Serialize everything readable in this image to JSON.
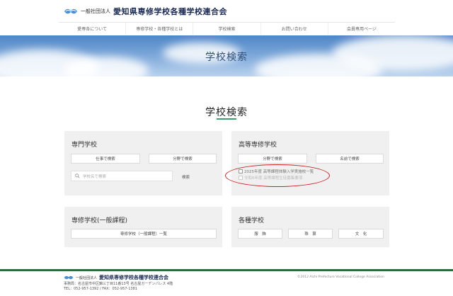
{
  "header": {
    "org_type": "一般社団法人",
    "org_name": "愛知県専修学校各種学校連合会",
    "nav": [
      "愛専各について",
      "専修学校・各種学校とは",
      "学校検索",
      "お問い合わせ",
      "会員専用ページ"
    ]
  },
  "hero": {
    "title": "学校検索"
  },
  "main": {
    "title": "学校検索",
    "accent_color": "#3aa06b",
    "panels": {
      "senmon": {
        "title": "専門学校",
        "btn_job": "仕事で検索",
        "btn_field": "分野で検索",
        "search_placeholder": "学校名で検索",
        "search_submit": "検索"
      },
      "koutou": {
        "title": "高等専修学校",
        "btn_field": "分野で検索",
        "btn_name": "名前で検索",
        "check1": "2025年度 高等課程体験入学実施校一覧",
        "check2": "令和6年度 高等課程生徒募集要項"
      },
      "ippan": {
        "title": "専修学校(一般課程)",
        "btn_list": "専修学校（一般課程）一覧"
      },
      "kakushu": {
        "title": "各種学校",
        "btn_sewing": "服　飾",
        "btn_abacus": "珠　算",
        "btn_culture": "文　化"
      }
    }
  },
  "footer": {
    "org_type": "一般社団法人",
    "org_name": "愛知県専修学校各種学校連合会",
    "address": "事務局：名古屋市中区錦三丁目11番13号 名古屋ガーデンパレス 4階",
    "contact": "TEL：052-957-1392 / FAX：052-957-1381",
    "copyright": "©2012 Aichi Prefecture Vocational College Association"
  },
  "colors": {
    "annotation_oval": "#cc2222",
    "footer_bar": "#2e6b3a"
  }
}
